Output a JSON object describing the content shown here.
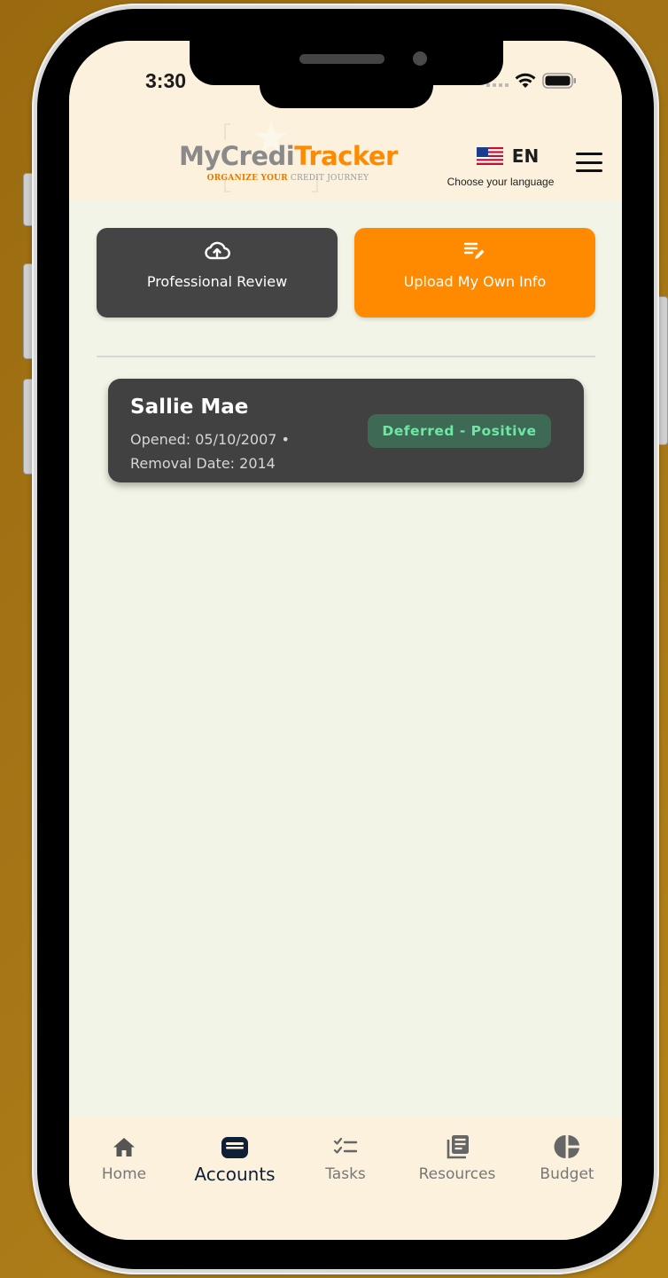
{
  "status_bar": {
    "time": "3:30"
  },
  "header": {
    "logo_part1": "MyCredi",
    "logo_part2": "Tracker",
    "tagline_part1": "ORGANIZE YOUR",
    "tagline_part2": "CREDIT JOURNEY",
    "language_code": "EN",
    "language_hint": "Choose your language"
  },
  "actions": {
    "professional_review": "Professional Review",
    "upload_own_info": "Upload My Own Info"
  },
  "accounts": [
    {
      "name": "Sallie Mae",
      "opened": "Opened: 05/10/2007 •",
      "removal": "Removal Date: 2014",
      "status": "Deferred - Positive"
    }
  ],
  "bottom_nav": [
    {
      "label": "Home",
      "icon": "home-icon",
      "active": false
    },
    {
      "label": "Accounts",
      "icon": "wallet-icon",
      "active": true
    },
    {
      "label": "Tasks",
      "icon": "tasks-icon",
      "active": false
    },
    {
      "label": "Resources",
      "icon": "resources-icon",
      "active": false
    },
    {
      "label": "Budget",
      "icon": "budget-icon",
      "active": false
    }
  ],
  "colors": {
    "accent": "#ff8a00",
    "card": "#414141",
    "badge_bg": "#3e6a55",
    "badge_text": "#6ee7a4",
    "header_bg": "#fbf1dc",
    "content_bg": "#f1f4e6",
    "backdrop": "#a47215"
  }
}
